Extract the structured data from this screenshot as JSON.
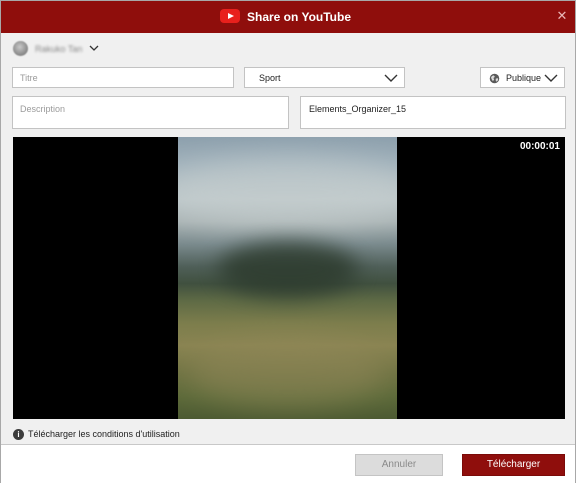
{
  "window": {
    "title": "Share on YouTube",
    "close_glyph": "✕"
  },
  "account": {
    "name": "Rakuko Tan"
  },
  "form": {
    "title_placeholder": "Titre",
    "category_value": "Sport",
    "privacy_value": "Publique",
    "description_placeholder": "Description",
    "filename_value": "Elements_Organizer_15"
  },
  "video": {
    "timecode": "00:00:01"
  },
  "terms": {
    "info_glyph": "i",
    "label": "Télécharger les conditions d'utilisation"
  },
  "buttons": {
    "cancel_label": "Annuler",
    "upload_label": "Télécharger"
  },
  "colors": {
    "brand": "#8f0e0c",
    "youtube_red": "#e8201c"
  },
  "icons": [
    "youtube-logo-icon",
    "close-icon",
    "avatar",
    "chevron-down-icon",
    "globe-icon",
    "info-icon"
  ]
}
